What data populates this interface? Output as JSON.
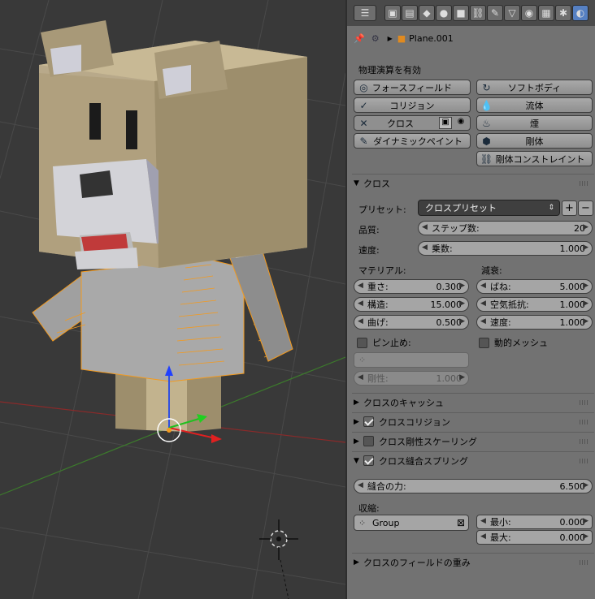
{
  "header": {
    "icons": [
      "editor-type-icon",
      "render-icon",
      "render-layers-icon",
      "scene-icon",
      "world-icon",
      "object-icon",
      "constraints-icon",
      "modifiers-icon",
      "data-icon",
      "material-icon",
      "texture-icon",
      "particles-icon",
      "physics-icon"
    ]
  },
  "context": {
    "object_name": "Plane.001"
  },
  "physics": {
    "enable_label": "物理演算を有効",
    "buttons": [
      {
        "label": "フォースフィールド",
        "icon": "force-field-icon"
      },
      {
        "label": "ソフトボディ",
        "icon": "soft-body-icon"
      },
      {
        "label": "コリジョン",
        "icon": "collision-icon"
      },
      {
        "label": "流体",
        "icon": "fluid-icon"
      },
      {
        "label": "クロス",
        "icon": "close-icon"
      },
      {
        "label": "煙",
        "icon": "smoke-icon"
      },
      {
        "label": "ダイナミックペイント",
        "icon": "dynamic-paint-icon"
      },
      {
        "label": "剛体",
        "icon": "rigid-body-icon"
      },
      {
        "label": "剛体コンストレイント",
        "icon": "rigid-constraint-icon"
      }
    ]
  },
  "cloth": {
    "title": "クロス",
    "preset_label": "プリセット:",
    "preset_value": "クロスプリセット",
    "quality_label": "品質:",
    "steps_label": "ステップ数:",
    "steps_value": "20",
    "speed_label": "速度:",
    "multiplier_label": "乗数:",
    "multiplier_value": "1.000",
    "material_label": "マテリアル:",
    "damping_label": "減衰:",
    "mass_label": "重さ:",
    "mass_value": "0.300",
    "structure_label": "構造:",
    "structure_value": "15.000",
    "bending_label": "曲げ:",
    "bending_value": "0.500",
    "spring_label": "ばね:",
    "spring_value": "5.000",
    "air_label": "空気抵抗:",
    "air_value": "1.000",
    "velocity_label": "速度:",
    "velocity_value": "1.000",
    "pin_label": "ピン止め:",
    "dynamic_mesh_label": "動的メッシュ",
    "stiffness_label": "剛性:",
    "stiffness_value": "1.000"
  },
  "sections": {
    "cache": "クロスのキャッシュ",
    "collision": "クロスコリジョン",
    "stiffness_scaling": "クロス剛性スケーリング",
    "sewing": "クロス縫合スプリング",
    "field_weights": "クロスのフィールドの重み"
  },
  "sewing": {
    "force_label": "縫合の力:",
    "force_value": "6.500",
    "shrink_label": "収縮:",
    "group_value": "Group",
    "min_label": "最小:",
    "min_value": "0.000",
    "max_label": "最大:",
    "max_value": "0.000"
  },
  "colors": {
    "accent": "#5680c2",
    "selection": "#f39a1e",
    "panel": "#727272",
    "viewport": "#393939"
  }
}
